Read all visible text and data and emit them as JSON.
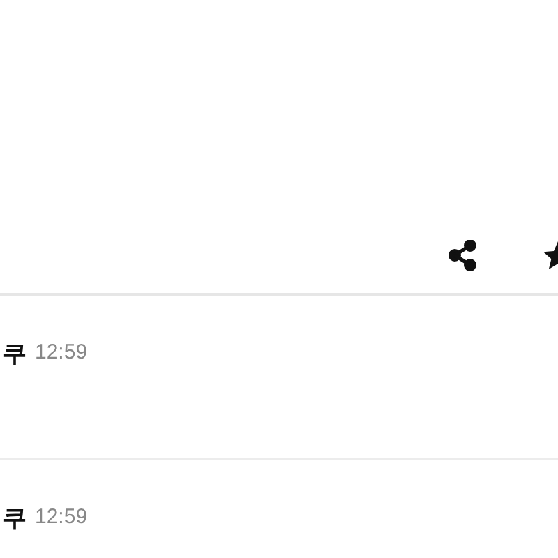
{
  "comments": [
    {
      "author": "쿠",
      "time": "12:59"
    },
    {
      "author": "쿠",
      "time": "12:59"
    }
  ]
}
